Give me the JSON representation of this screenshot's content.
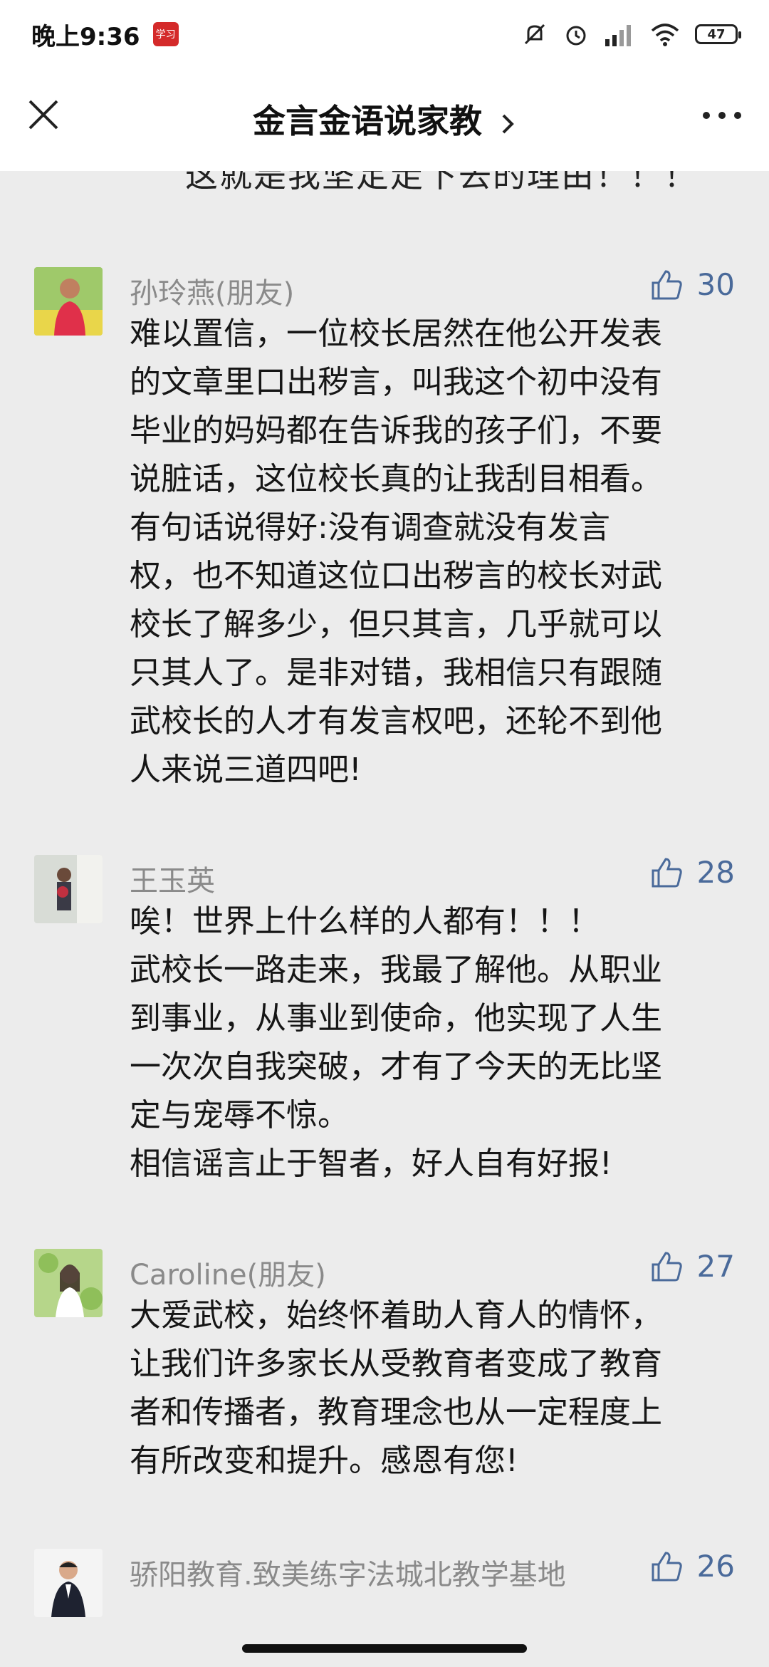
{
  "status": {
    "time": "晚上9:36",
    "app_badge": "学习",
    "battery": "47"
  },
  "nav": {
    "title": "金言金语说家教",
    "chevron_icon": "chevron-right-icon",
    "close_icon": "close-icon",
    "more_icon": "more-horizontal-icon"
  },
  "clipped_line": "这就是我坚定走下去的理由！！！",
  "comments": [
    {
      "name": "孙玲燕(朋友)",
      "likes": "30",
      "body": "难以置信，一位校长居然在他公开发表\n的文章里口出秽言，叫我这个初中没有\n毕业的妈妈都在告诉我的孩子们，不要\n说脏话，这位校长真的让我刮目相看。\n有句话说得好:没有调查就没有发言\n权，也不知道这位口出秽言的校长对武\n校长了解多少，但只其言，几乎就可以\n只其人了。是非对错，我相信只有跟随\n武校长的人才有发言权吧，还轮不到他\n人来说三道四吧!"
    },
    {
      "name": "王玉英",
      "likes": "28",
      "body": "唉！世界上什么样的人都有！！！\n武校长一路走来，我最了解他。从职业\n到事业，从事业到使命，他实现了人生\n一次次自我突破，才有了今天的无比坚\n定与宠辱不惊。\n相信谣言止于智者，好人自有好报!"
    },
    {
      "name": "Caroline(朋友)",
      "likes": "27",
      "body": "大爱武校，始终怀着助人育人的情怀，\n让我们许多家长从受教育者变成了教育\n者和传播者，教育理念也从一定程度上\n有所改变和提升。感恩有您!"
    },
    {
      "name": "骄阳教育.致美练字法城北教学基地",
      "likes": "26",
      "body": ""
    }
  ],
  "colors": {
    "background": "#ececec",
    "like_color": "#4a6a9a",
    "name_color": "#8a8a8a"
  }
}
